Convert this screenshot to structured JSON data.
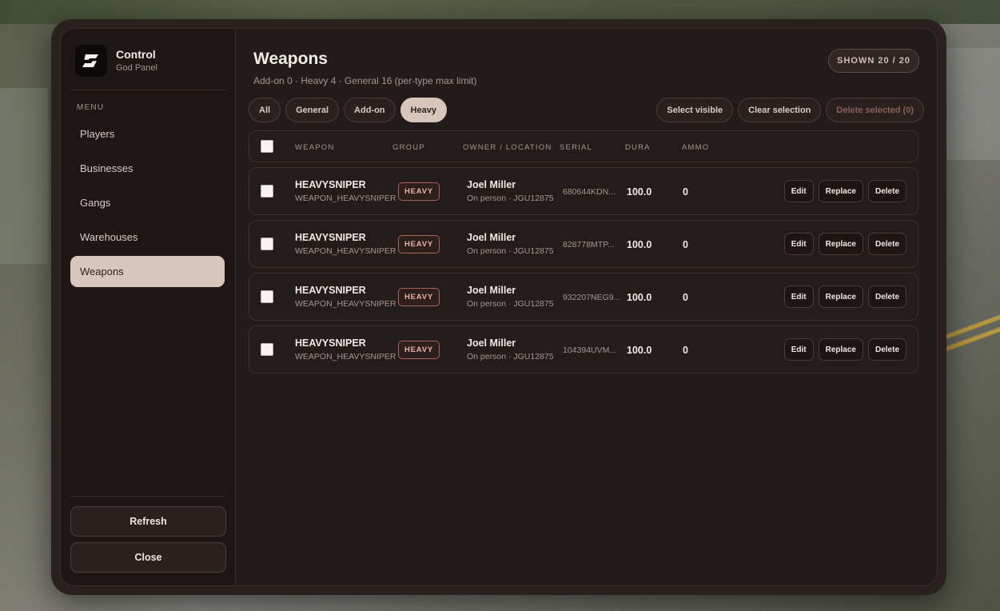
{
  "brand": {
    "title": "Control",
    "subtitle": "God Panel"
  },
  "sidebar": {
    "menu_label": "MENU",
    "items": [
      {
        "label": "Players",
        "active": false
      },
      {
        "label": "Businesses",
        "active": false
      },
      {
        "label": "Gangs",
        "active": false
      },
      {
        "label": "Warehouses",
        "active": false
      },
      {
        "label": "Weapons",
        "active": true
      }
    ],
    "refresh_label": "Refresh",
    "close_label": "Close"
  },
  "main": {
    "title": "Weapons",
    "subtitle": "Add-on 0 · Heavy 4 · General 16 (per-type max limit)",
    "shown": "SHOWN 20 / 20",
    "filters": [
      {
        "label": "All",
        "active": false
      },
      {
        "label": "General",
        "active": false
      },
      {
        "label": "Add-on",
        "active": false
      },
      {
        "label": "Heavy",
        "active": true
      }
    ],
    "actions": {
      "select_visible": "Select visible",
      "clear_selection": "Clear selection",
      "delete_selected": "Delete selected (0)"
    },
    "columns": {
      "weapon": "WEAPON",
      "group": "GROUP",
      "owner": "OWNER / LOCATION",
      "serial": "SERIAL",
      "dura": "DURA",
      "ammo": "AMMO"
    },
    "rows": [
      {
        "name": "HEAVYSNIPER",
        "code": "WEAPON_HEAVYSNIPER",
        "group": "HEAVY",
        "owner": "Joel Miller",
        "location": "On person · JGU12875",
        "serial": "680644KDN...",
        "dura": "100.0",
        "ammo": "0"
      },
      {
        "name": "HEAVYSNIPER",
        "code": "WEAPON_HEAVYSNIPER",
        "group": "HEAVY",
        "owner": "Joel Miller",
        "location": "On person · JGU12875",
        "serial": "828778MTP...",
        "dura": "100.0",
        "ammo": "0"
      },
      {
        "name": "HEAVYSNIPER",
        "code": "WEAPON_HEAVYSNIPER",
        "group": "HEAVY",
        "owner": "Joel Miller",
        "location": "On person · JGU12875",
        "serial": "932207NEG9...",
        "dura": "100.0",
        "ammo": "0"
      },
      {
        "name": "HEAVYSNIPER",
        "code": "WEAPON_HEAVYSNIPER",
        "group": "HEAVY",
        "owner": "Joel Miller",
        "location": "On person · JGU12875",
        "serial": "104394UVM...",
        "dura": "100.0",
        "ammo": "0"
      }
    ],
    "row_buttons": {
      "edit": "Edit",
      "replace": "Replace",
      "delete": "Delete"
    }
  },
  "colors": {
    "panel": "#221b19",
    "sidebar": "#1d1614",
    "accent": "#d8c6bd",
    "badge_border": "#a9625a"
  }
}
